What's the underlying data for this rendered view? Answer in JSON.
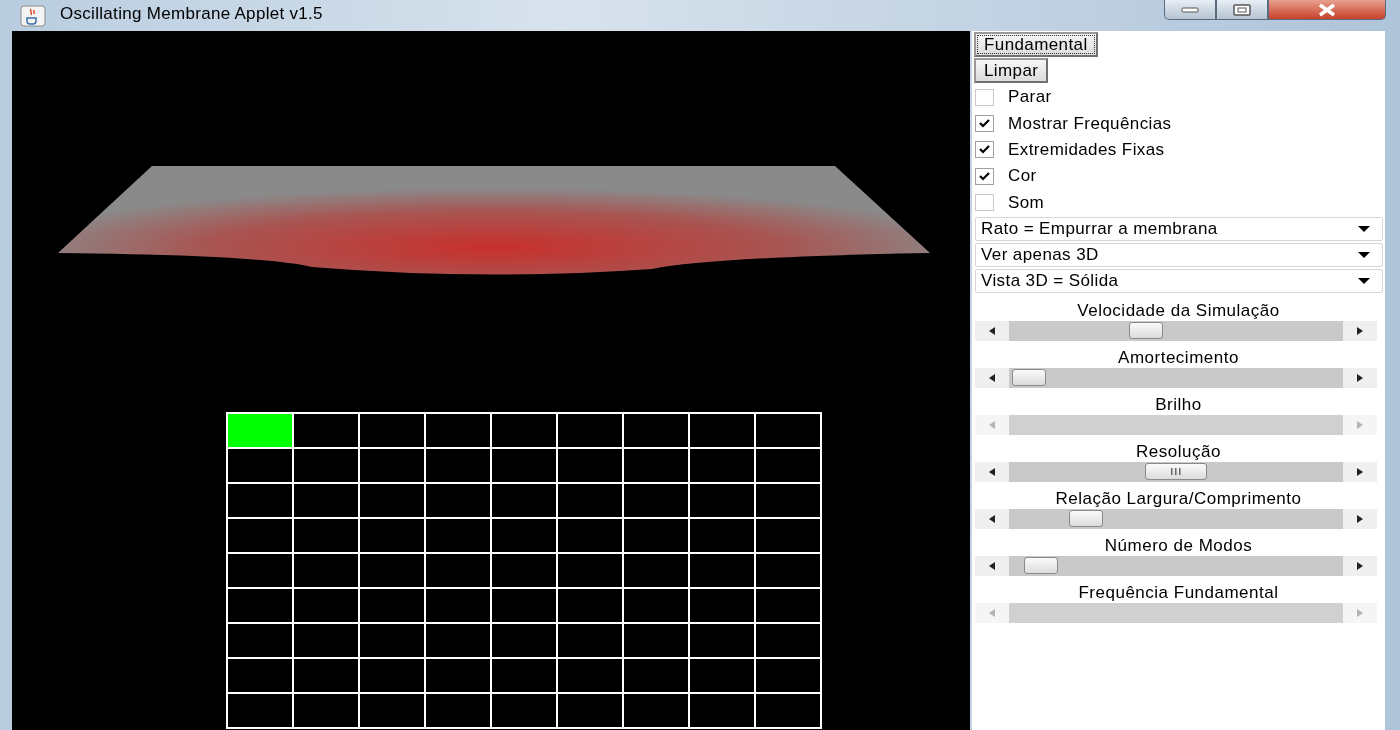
{
  "window": {
    "title": "Oscillating Membrane Applet v1.5"
  },
  "buttons": [
    {
      "label": "Fundamental",
      "focused": true
    },
    {
      "label": "Limpar",
      "focused": false
    }
  ],
  "checkboxes": [
    {
      "label": "Parar",
      "checked": false
    },
    {
      "label": "Mostrar Frequências",
      "checked": true
    },
    {
      "label": "Extremidades Fixas",
      "checked": true
    },
    {
      "label": "Cor",
      "checked": true
    },
    {
      "label": "Som",
      "checked": false
    }
  ],
  "dropdowns": [
    {
      "value": "Rato = Empurrar a membrana"
    },
    {
      "value": "Ver apenas 3D"
    },
    {
      "value": "Vista 3D = Sólida"
    }
  ],
  "sliders": [
    {
      "label": "Velocidade da Simulação",
      "disabled": false,
      "level": 0.4,
      "grip": false
    },
    {
      "label": "Amortecimento",
      "disabled": false,
      "level": 0.01,
      "grip": false
    },
    {
      "label": "Brilho",
      "disabled": true
    },
    {
      "label": "Resolução",
      "disabled": false,
      "level": 0.5,
      "grip": true
    },
    {
      "label": "Relação Largura/Comprimento",
      "disabled": false,
      "level": 0.2,
      "grip": false
    },
    {
      "label": "Número de Modos",
      "disabled": false,
      "level": 0.05,
      "grip": false
    },
    {
      "label": "Frequência Fundamental",
      "disabled": true
    }
  ],
  "mode_grid": [
    [
      {
        "selected": true
      },
      {
        "selected": false
      },
      {
        "selected": false
      },
      {
        "selected": false
      },
      {
        "selected": false
      },
      {
        "selected": false
      },
      {
        "selected": false
      },
      {
        "selected": false
      },
      {
        "selected": false
      }
    ],
    [
      {
        "selected": false
      },
      {
        "selected": false
      },
      {
        "selected": false
      },
      {
        "selected": false
      },
      {
        "selected": false
      },
      {
        "selected": false
      },
      {
        "selected": false
      },
      {
        "selected": false
      },
      {
        "selected": false
      }
    ],
    [
      {
        "selected": false
      },
      {
        "selected": false
      },
      {
        "selected": false
      },
      {
        "selected": false
      },
      {
        "selected": false
      },
      {
        "selected": false
      },
      {
        "selected": false
      },
      {
        "selected": false
      },
      {
        "selected": false
      }
    ],
    [
      {
        "selected": false
      },
      {
        "selected": false
      },
      {
        "selected": false
      },
      {
        "selected": false
      },
      {
        "selected": false
      },
      {
        "selected": false
      },
      {
        "selected": false
      },
      {
        "selected": false
      },
      {
        "selected": false
      }
    ],
    [
      {
        "selected": false
      },
      {
        "selected": false
      },
      {
        "selected": false
      },
      {
        "selected": false
      },
      {
        "selected": false
      },
      {
        "selected": false
      },
      {
        "selected": false
      },
      {
        "selected": false
      },
      {
        "selected": false
      }
    ],
    [
      {
        "selected": false
      },
      {
        "selected": false
      },
      {
        "selected": false
      },
      {
        "selected": false
      },
      {
        "selected": false
      },
      {
        "selected": false
      },
      {
        "selected": false
      },
      {
        "selected": false
      },
      {
        "selected": false
      }
    ],
    [
      {
        "selected": false
      },
      {
        "selected": false
      },
      {
        "selected": false
      },
      {
        "selected": false
      },
      {
        "selected": false
      },
      {
        "selected": false
      },
      {
        "selected": false
      },
      {
        "selected": false
      },
      {
        "selected": false
      }
    ],
    [
      {
        "selected": false
      },
      {
        "selected": false
      },
      {
        "selected": false
      },
      {
        "selected": false
      },
      {
        "selected": false
      },
      {
        "selected": false
      },
      {
        "selected": false
      },
      {
        "selected": false
      },
      {
        "selected": false
      }
    ],
    [
      {
        "selected": false
      },
      {
        "selected": false
      },
      {
        "selected": false
      },
      {
        "selected": false
      },
      {
        "selected": false
      },
      {
        "selected": false
      },
      {
        "selected": false
      },
      {
        "selected": false
      },
      {
        "selected": false
      }
    ]
  ]
}
